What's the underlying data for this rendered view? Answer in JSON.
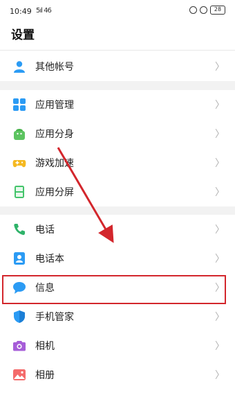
{
  "status_bar": {
    "time": "10:49",
    "signal": "5ıl 46",
    "battery": "28"
  },
  "header": {
    "title": "设置"
  },
  "groups": [
    {
      "items": [
        {
          "label": "其他帐号",
          "icon": "person-icon"
        }
      ]
    },
    {
      "items": [
        {
          "label": "应用管理",
          "icon": "app-grid-icon"
        },
        {
          "label": "应用分身",
          "icon": "android-icon"
        },
        {
          "label": "游戏加速",
          "icon": "gamepad-icon"
        },
        {
          "label": "应用分屏",
          "icon": "split-screen-icon"
        }
      ]
    },
    {
      "items": [
        {
          "label": "电话",
          "icon": "phone-icon"
        },
        {
          "label": "电话本",
          "icon": "contacts-icon"
        },
        {
          "label": "信息",
          "icon": "message-icon"
        },
        {
          "label": "手机管家",
          "icon": "shield-icon"
        },
        {
          "label": "相机",
          "icon": "camera-icon"
        },
        {
          "label": "相册",
          "icon": "gallery-icon"
        }
      ]
    }
  ],
  "chevron": "〉",
  "colors": {
    "annotation": "#d3262c",
    "primary": "#2b9bf4"
  }
}
